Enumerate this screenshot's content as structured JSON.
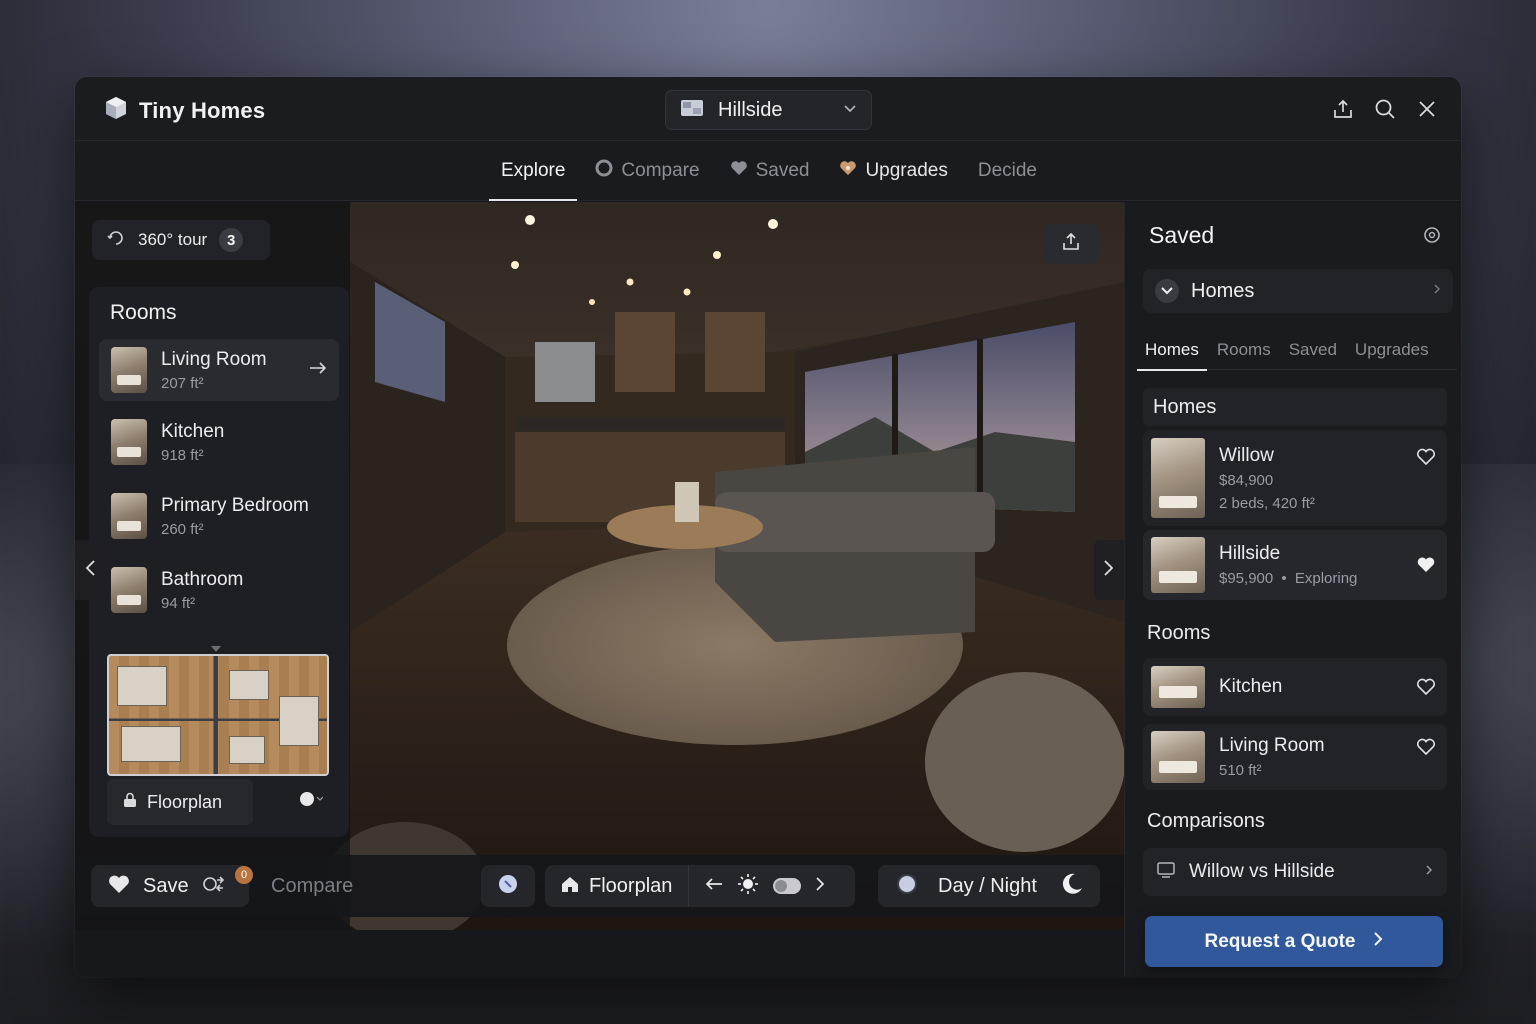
{
  "app": {
    "name": "Tiny Homes"
  },
  "home_select": {
    "value": "Hillside"
  },
  "tabs": [
    {
      "label": "Explore",
      "icon": ""
    },
    {
      "label": "Compare",
      "icon": "circle-icon"
    },
    {
      "label": "Saved",
      "icon": "heart-icon"
    },
    {
      "label": "Upgrades",
      "icon": "heart-badge-icon"
    },
    {
      "label": "Decide",
      "icon": ""
    }
  ],
  "tour": {
    "label": "360° tour",
    "count": "3"
  },
  "rooms_panel": {
    "title": "Rooms",
    "items": [
      {
        "name": "Living Room",
        "size": "207 ft²"
      },
      {
        "name": "Kitchen",
        "size": "918 ft²"
      },
      {
        "name": "Primary Bedroom",
        "size": "260 ft²"
      },
      {
        "name": "Bathroom",
        "size": "94 ft²"
      }
    ],
    "floorplan_label": "Floorplan"
  },
  "bottom_bar": {
    "save_label": "Save",
    "notif_count": "0",
    "compare_label": "Compare",
    "floorplan_label": "Floorplan",
    "daynight_label": "Day / Night"
  },
  "saved_panel": {
    "title": "Saved",
    "select_value": "Homes",
    "tabs": [
      "Homes",
      "Rooms",
      "Saved",
      "Upgrades"
    ],
    "homes_header": "Homes",
    "homes": [
      {
        "name": "Willow",
        "price": "$84,900",
        "details": "2 beds, 420 ft²",
        "status": "",
        "liked": false
      },
      {
        "name": "Hillside",
        "price": "$95,900",
        "details": "",
        "status": "Exploring",
        "liked": true
      }
    ],
    "rooms_header": "Rooms",
    "rooms": [
      {
        "name": "Kitchen",
        "size": ""
      },
      {
        "name": "Living Room",
        "size": "510 ft²"
      }
    ],
    "comparisons_header": "Comparisons",
    "comparison": "Willow vs Hillside"
  },
  "cta": {
    "label": "Request a Quote"
  },
  "colors": {
    "accent": "#30589a",
    "badge": "#b9743f"
  }
}
